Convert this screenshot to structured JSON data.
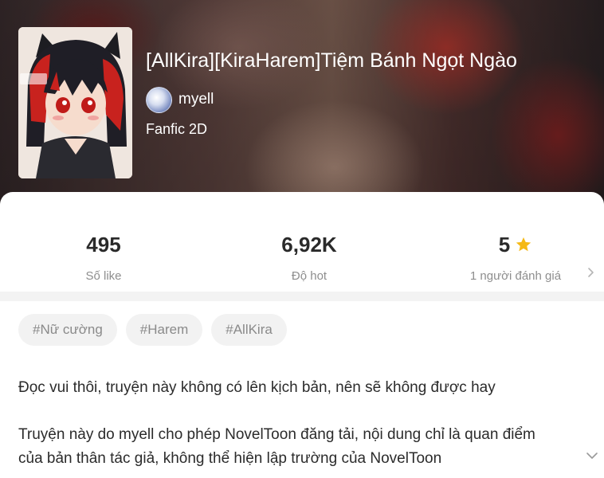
{
  "book": {
    "title": "[AllKira][KiraHarem]Tiệm Bánh Ngọt Ngào",
    "author": "myell",
    "category": "Fanfic 2D"
  },
  "stats": [
    {
      "value": "495",
      "label": "Số like"
    },
    {
      "value": "6,92K",
      "label": "Độ hot"
    },
    {
      "value": "5",
      "label": "1 người đánh giá"
    }
  ],
  "tags": [
    "#Nữ cường",
    "#Harem",
    "#AllKira"
  ],
  "description": {
    "line1": "Đọc vui thôi, truyện này không có lên kịch bản, nên sẽ không được hay",
    "line2": "Truyện này do myell cho phép NovelToon đăng tải, nội dung chỉ là quan điểm",
    "line3": "của bản thân tác giả, không thể hiện lập trường của NovelToon"
  },
  "colors": {
    "star": "#f5b915",
    "tag_bg": "#f2f2f2",
    "divider": "#f3f3f3"
  },
  "icons": {
    "rating": "star-icon",
    "more": "chevron-right-icon",
    "expand": "chevron-down-icon"
  }
}
